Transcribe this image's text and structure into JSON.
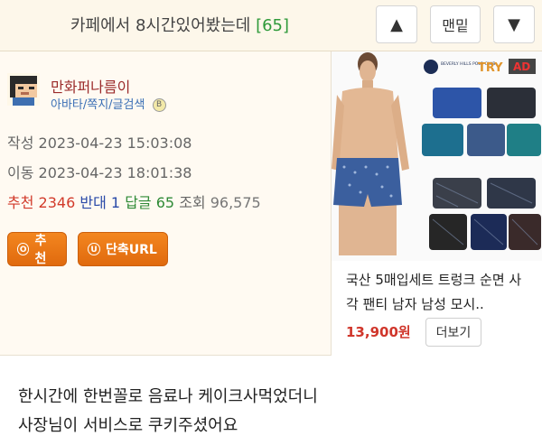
{
  "header": {
    "title": "카페에서 8시간있어봤는데",
    "comment_count": "[65]",
    "up_label": "▲",
    "bottom_label": "맨밑",
    "down_label": "▼"
  },
  "author": {
    "nickname": "만화퍼나름이",
    "links": "아바타/쪽지/글검색",
    "level_badge": "B"
  },
  "meta": {
    "written": "작성 2023-04-23 15:03:08",
    "moved": "이동 2023-04-23 18:01:38"
  },
  "stats": {
    "recommend_label": "추천",
    "recommend": "2346",
    "oppose_label": "반대",
    "oppose": "1",
    "reply_label": "답글",
    "reply": "65",
    "view_label": "조회",
    "view": "96,575"
  },
  "actions": {
    "recommend_button": "추천",
    "shorturl_button": "단축URL",
    "icon_letter_rec": "O",
    "icon_letter_url": "U"
  },
  "ad": {
    "brand_a": "BEVERLY HILLS POLO CLUB",
    "brand_b": "TRY",
    "brand_c": "AD",
    "title": "국산 5매입세트 트렁크 순면 사\n각 팬티 남자 남성 모시..",
    "price": "13,900원",
    "more_button": "더보기"
  },
  "body": {
    "line1": "한시간에 한번꼴로 음료나 케이크사먹었더니",
    "line2": "사장님이 서비스로 쿠키주셨어요"
  }
}
